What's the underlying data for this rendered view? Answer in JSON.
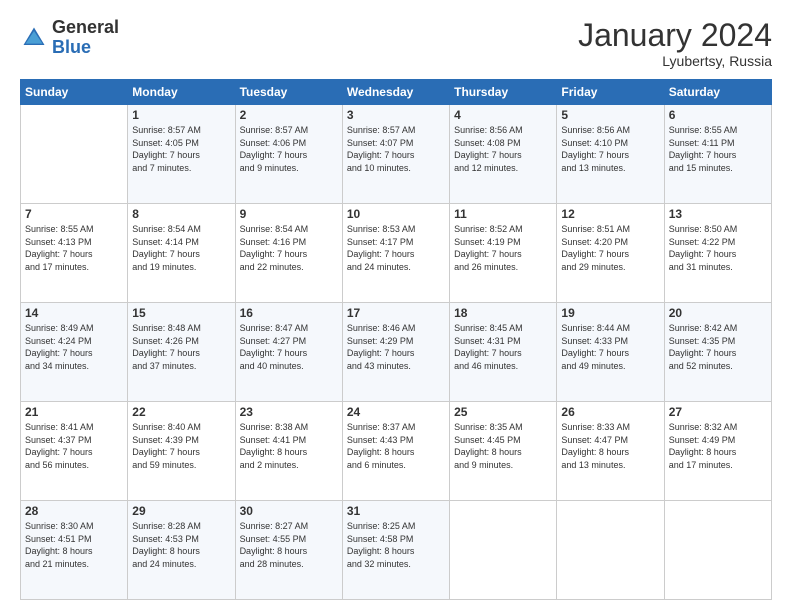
{
  "logo": {
    "general": "General",
    "blue": "Blue"
  },
  "header": {
    "month": "January 2024",
    "location": "Lyubertsy, Russia"
  },
  "days_of_week": [
    "Sunday",
    "Monday",
    "Tuesday",
    "Wednesday",
    "Thursday",
    "Friday",
    "Saturday"
  ],
  "weeks": [
    [
      {
        "day": "",
        "info": ""
      },
      {
        "day": "1",
        "info": "Sunrise: 8:57 AM\nSunset: 4:05 PM\nDaylight: 7 hours\nand 7 minutes."
      },
      {
        "day": "2",
        "info": "Sunrise: 8:57 AM\nSunset: 4:06 PM\nDaylight: 7 hours\nand 9 minutes."
      },
      {
        "day": "3",
        "info": "Sunrise: 8:57 AM\nSunset: 4:07 PM\nDaylight: 7 hours\nand 10 minutes."
      },
      {
        "day": "4",
        "info": "Sunrise: 8:56 AM\nSunset: 4:08 PM\nDaylight: 7 hours\nand 12 minutes."
      },
      {
        "day": "5",
        "info": "Sunrise: 8:56 AM\nSunset: 4:10 PM\nDaylight: 7 hours\nand 13 minutes."
      },
      {
        "day": "6",
        "info": "Sunrise: 8:55 AM\nSunset: 4:11 PM\nDaylight: 7 hours\nand 15 minutes."
      }
    ],
    [
      {
        "day": "7",
        "info": "Sunrise: 8:55 AM\nSunset: 4:13 PM\nDaylight: 7 hours\nand 17 minutes."
      },
      {
        "day": "8",
        "info": "Sunrise: 8:54 AM\nSunset: 4:14 PM\nDaylight: 7 hours\nand 19 minutes."
      },
      {
        "day": "9",
        "info": "Sunrise: 8:54 AM\nSunset: 4:16 PM\nDaylight: 7 hours\nand 22 minutes."
      },
      {
        "day": "10",
        "info": "Sunrise: 8:53 AM\nSunset: 4:17 PM\nDaylight: 7 hours\nand 24 minutes."
      },
      {
        "day": "11",
        "info": "Sunrise: 8:52 AM\nSunset: 4:19 PM\nDaylight: 7 hours\nand 26 minutes."
      },
      {
        "day": "12",
        "info": "Sunrise: 8:51 AM\nSunset: 4:20 PM\nDaylight: 7 hours\nand 29 minutes."
      },
      {
        "day": "13",
        "info": "Sunrise: 8:50 AM\nSunset: 4:22 PM\nDaylight: 7 hours\nand 31 minutes."
      }
    ],
    [
      {
        "day": "14",
        "info": "Sunrise: 8:49 AM\nSunset: 4:24 PM\nDaylight: 7 hours\nand 34 minutes."
      },
      {
        "day": "15",
        "info": "Sunrise: 8:48 AM\nSunset: 4:26 PM\nDaylight: 7 hours\nand 37 minutes."
      },
      {
        "day": "16",
        "info": "Sunrise: 8:47 AM\nSunset: 4:27 PM\nDaylight: 7 hours\nand 40 minutes."
      },
      {
        "day": "17",
        "info": "Sunrise: 8:46 AM\nSunset: 4:29 PM\nDaylight: 7 hours\nand 43 minutes."
      },
      {
        "day": "18",
        "info": "Sunrise: 8:45 AM\nSunset: 4:31 PM\nDaylight: 7 hours\nand 46 minutes."
      },
      {
        "day": "19",
        "info": "Sunrise: 8:44 AM\nSunset: 4:33 PM\nDaylight: 7 hours\nand 49 minutes."
      },
      {
        "day": "20",
        "info": "Sunrise: 8:42 AM\nSunset: 4:35 PM\nDaylight: 7 hours\nand 52 minutes."
      }
    ],
    [
      {
        "day": "21",
        "info": "Sunrise: 8:41 AM\nSunset: 4:37 PM\nDaylight: 7 hours\nand 56 minutes."
      },
      {
        "day": "22",
        "info": "Sunrise: 8:40 AM\nSunset: 4:39 PM\nDaylight: 7 hours\nand 59 minutes."
      },
      {
        "day": "23",
        "info": "Sunrise: 8:38 AM\nSunset: 4:41 PM\nDaylight: 8 hours\nand 2 minutes."
      },
      {
        "day": "24",
        "info": "Sunrise: 8:37 AM\nSunset: 4:43 PM\nDaylight: 8 hours\nand 6 minutes."
      },
      {
        "day": "25",
        "info": "Sunrise: 8:35 AM\nSunset: 4:45 PM\nDaylight: 8 hours\nand 9 minutes."
      },
      {
        "day": "26",
        "info": "Sunrise: 8:33 AM\nSunset: 4:47 PM\nDaylight: 8 hours\nand 13 minutes."
      },
      {
        "day": "27",
        "info": "Sunrise: 8:32 AM\nSunset: 4:49 PM\nDaylight: 8 hours\nand 17 minutes."
      }
    ],
    [
      {
        "day": "28",
        "info": "Sunrise: 8:30 AM\nSunset: 4:51 PM\nDaylight: 8 hours\nand 21 minutes."
      },
      {
        "day": "29",
        "info": "Sunrise: 8:28 AM\nSunset: 4:53 PM\nDaylight: 8 hours\nand 24 minutes."
      },
      {
        "day": "30",
        "info": "Sunrise: 8:27 AM\nSunset: 4:55 PM\nDaylight: 8 hours\nand 28 minutes."
      },
      {
        "day": "31",
        "info": "Sunrise: 8:25 AM\nSunset: 4:58 PM\nDaylight: 8 hours\nand 32 minutes."
      },
      {
        "day": "",
        "info": ""
      },
      {
        "day": "",
        "info": ""
      },
      {
        "day": "",
        "info": ""
      }
    ]
  ]
}
